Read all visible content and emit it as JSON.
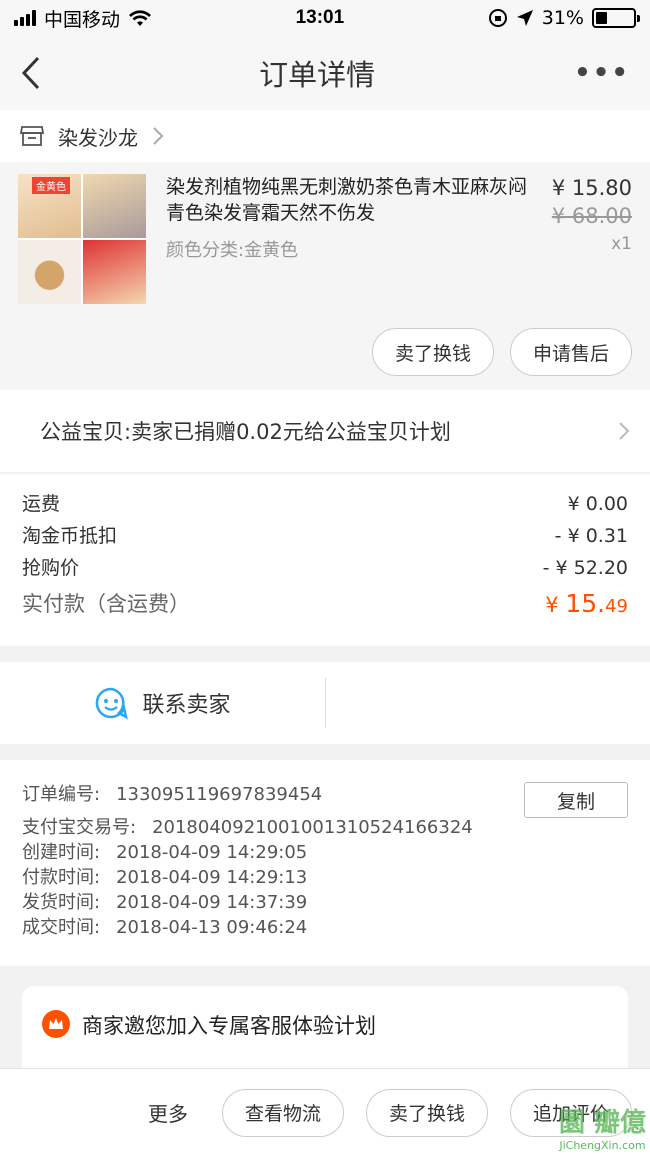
{
  "status": {
    "carrier": "中国移动",
    "time": "13:01",
    "battery": "31%",
    "battery_level": 0.31
  },
  "nav": {
    "title": "订单详情",
    "more": "•••"
  },
  "shop": {
    "name": "染发沙龙"
  },
  "product": {
    "thumb_tag": "金黄色",
    "title": "染发剂植物纯黑无刺激奶茶色青木亚麻灰闷青色染发膏霜天然不伤发",
    "sku": "颜色分类:金黄色",
    "price": "¥ 15.80",
    "original_price": "¥ 68.00",
    "qty": "x1",
    "buttons": {
      "sell": "卖了换钱",
      "aftersale": "申请售后"
    }
  },
  "charity": {
    "text": "公益宝贝:卖家已捐赠0.02元给公益宝贝计划"
  },
  "fees": {
    "rows": [
      {
        "label": "运费",
        "value": "¥ 0.00"
      },
      {
        "label": "淘金币抵扣",
        "value": "- ¥ 0.31"
      },
      {
        "label": "抢购价",
        "value": "- ¥ 52.20"
      }
    ],
    "total_label": "实付款（含运费）",
    "total_symbol": "¥ ",
    "total_int": "15.",
    "total_dec": "49"
  },
  "contact": {
    "label": "联系卖家"
  },
  "order": {
    "copy": "复制",
    "lines": [
      {
        "label": "订单编号:",
        "value": "133095119697839454"
      },
      {
        "label": "支付宝交易号:",
        "value": "2018040921001001310524166324"
      },
      {
        "label": "创建时间:",
        "value": "2018-04-09 14:29:05"
      },
      {
        "label": "付款时间:",
        "value": "2018-04-09 14:29:13"
      },
      {
        "label": "发货时间:",
        "value": "2018-04-09 14:37:39"
      },
      {
        "label": "成交时间:",
        "value": "2018-04-13 09:46:24"
      }
    ]
  },
  "invite": {
    "text": "商家邀您加入专属客服体验计划"
  },
  "bottom": {
    "more": "更多",
    "logistics": "查看物流",
    "sell": "卖了换钱",
    "review": "追加评价"
  },
  "watermark": {
    "logo": "圜 瓣億",
    "url": "JiChengXin.com"
  },
  "colors": {
    "accent": "#ff5000",
    "contact_icon": "#2aa7f0"
  },
  "icons": {
    "back": "chevron-left-icon",
    "shop": "shop-icon",
    "chevron": "chevron-right-icon",
    "contact": "chat-smile-icon",
    "crown": "crown-icon"
  }
}
